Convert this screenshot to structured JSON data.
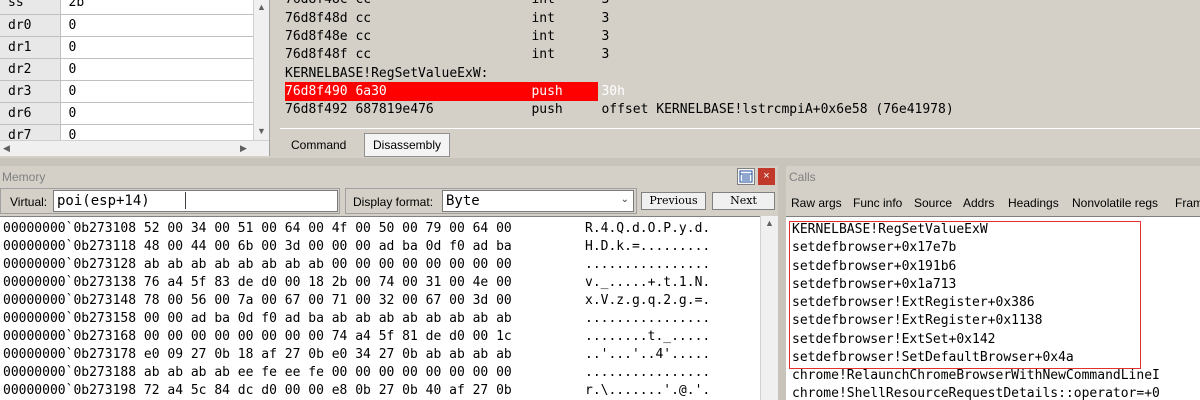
{
  "registers": [
    {
      "name": "ss",
      "value": "2b"
    },
    {
      "name": "dr0",
      "value": "0"
    },
    {
      "name": "dr1",
      "value": "0"
    },
    {
      "name": "dr2",
      "value": "0"
    },
    {
      "name": "dr3",
      "value": "0"
    },
    {
      "name": "dr6",
      "value": "0"
    },
    {
      "name": "dr7",
      "value": "0"
    }
  ],
  "disassembly": [
    {
      "addr": "76d8f48c",
      "bytes": "cc",
      "mnemonic": "int",
      "operand": "3"
    },
    {
      "addr": "76d8f48d",
      "bytes": "cc",
      "mnemonic": "int",
      "operand": "3"
    },
    {
      "addr": "76d8f48e",
      "bytes": "cc",
      "mnemonic": "int",
      "operand": "3"
    },
    {
      "addr": "76d8f48f",
      "bytes": "cc",
      "mnemonic": "int",
      "operand": "3"
    },
    {
      "label": "KERNELBASE!RegSetValueExW:"
    },
    {
      "addr": "76d8f490",
      "bytes": "6a30",
      "mnemonic": "push",
      "operand": "30h",
      "highlighted": true
    },
    {
      "addr": "76d8f492",
      "bytes": "687819e476",
      "mnemonic": "push",
      "operand": "offset KERNELBASE!lstrcmpiA+0x6e58 (76e41978)"
    }
  ],
  "tabs": [
    {
      "label": "Command",
      "active": false
    },
    {
      "label": "Disassembly",
      "active": true
    }
  ],
  "memory": {
    "title": "Memory",
    "virtual_label": "Virtual:",
    "virtual_value": "poi(esp+14)",
    "display_format_label": "Display format:",
    "display_format_value": "Byte",
    "previous_label": "Previous",
    "next_label": "Next",
    "rows": [
      {
        "addr": "00000000`0b273108",
        "hex": "52 00 34 00 51 00 64 00 4f 00 50 00 79 00 64 00",
        "ascii": "R.4.Q.d.O.P.y.d."
      },
      {
        "addr": "00000000`0b273118",
        "hex": "48 00 44 00 6b 00 3d 00 00 00 ad ba 0d f0 ad ba",
        "ascii": "H.D.k.=........."
      },
      {
        "addr": "00000000`0b273128",
        "hex": "ab ab ab ab ab ab ab ab 00 00 00 00 00 00 00 00",
        "ascii": "................"
      },
      {
        "addr": "00000000`0b273138",
        "hex": "76 a4 5f 83 de d0 00 18 2b 00 74 00 31 00 4e 00",
        "ascii": "v._.....+.t.1.N."
      },
      {
        "addr": "00000000`0b273148",
        "hex": "78 00 56 00 7a 00 67 00 71 00 32 00 67 00 3d 00",
        "ascii": "x.V.z.g.q.2.g.=."
      },
      {
        "addr": "00000000`0b273158",
        "hex": "00 00 ad ba 0d f0 ad ba ab ab ab ab ab ab ab ab",
        "ascii": "................"
      },
      {
        "addr": "00000000`0b273168",
        "hex": "00 00 00 00 00 00 00 00 74 a4 5f 81 de d0 00 1c",
        "ascii": "........t._....."
      },
      {
        "addr": "00000000`0b273178",
        "hex": "e0 09 27 0b 18 af 27 0b e0 34 27 0b ab ab ab ab",
        "ascii": "..'...'..4'....."
      },
      {
        "addr": "00000000`0b273188",
        "hex": "ab ab ab ab ee fe ee fe 00 00 00 00 00 00 00 00",
        "ascii": "................"
      },
      {
        "addr": "00000000`0b273198",
        "hex": "72 a4 5c 84 dc d0 00 00 e8 0b 27 0b 40 af 27 0b",
        "ascii": "r.\\.......'.@.'."
      }
    ]
  },
  "calls": {
    "title": "Calls",
    "toolbar": [
      "Raw args",
      "Func info",
      "Source",
      "Addrs",
      "Headings",
      "Nonvolatile regs",
      "Fram"
    ],
    "frames": [
      "KERNELBASE!RegSetValueExW",
      "setdefbrowser+0x17e7b",
      "setdefbrowser+0x191b6",
      "setdefbrowser+0x1a713",
      "setdefbrowser!ExtRegister+0x386",
      "setdefbrowser!ExtRegister+0x1138",
      "setdefbrowser!ExtSet+0x142",
      "setdefbrowser!SetDefaultBrowser+0x4a",
      "chrome!RelaunchChromeBrowserWithNewCommandLineI",
      "chrome!ShellResourceRequestDetails::operator=+0"
    ]
  },
  "colors": {
    "highlight": "#ff0000",
    "calls_box": "#e03030"
  }
}
